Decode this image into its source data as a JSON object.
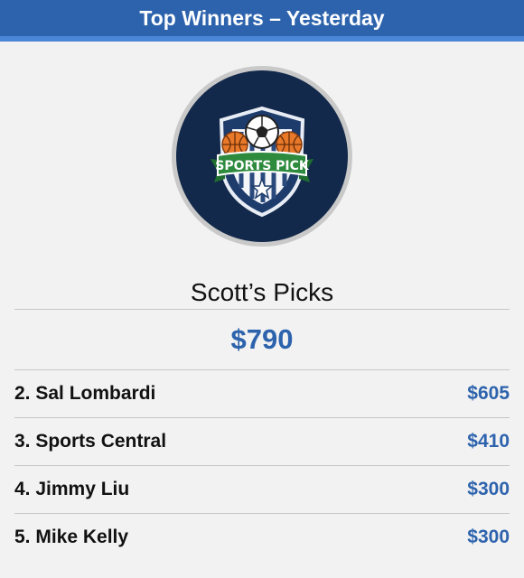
{
  "header": {
    "title": "Top Winners – Yesterday"
  },
  "logo": {
    "icon": "sports-pick-shield-logo",
    "banner_text": "SPORTS PICK"
  },
  "winner": {
    "name": "Scott’s Picks",
    "amount": "$790"
  },
  "rows": [
    {
      "name": "2. Sal Lombardi",
      "amount": "$605"
    },
    {
      "name": "3. Sports Central",
      "amount": "$410"
    },
    {
      "name": "4. Jimmy Liu",
      "amount": "$300"
    },
    {
      "name": "5. Mike Kelly",
      "amount": "$300"
    }
  ],
  "colors": {
    "header_bg": "#2d63ad",
    "accent": "#2d63ad",
    "logo_bg": "#13294b",
    "banner": "#2e8b3e"
  }
}
